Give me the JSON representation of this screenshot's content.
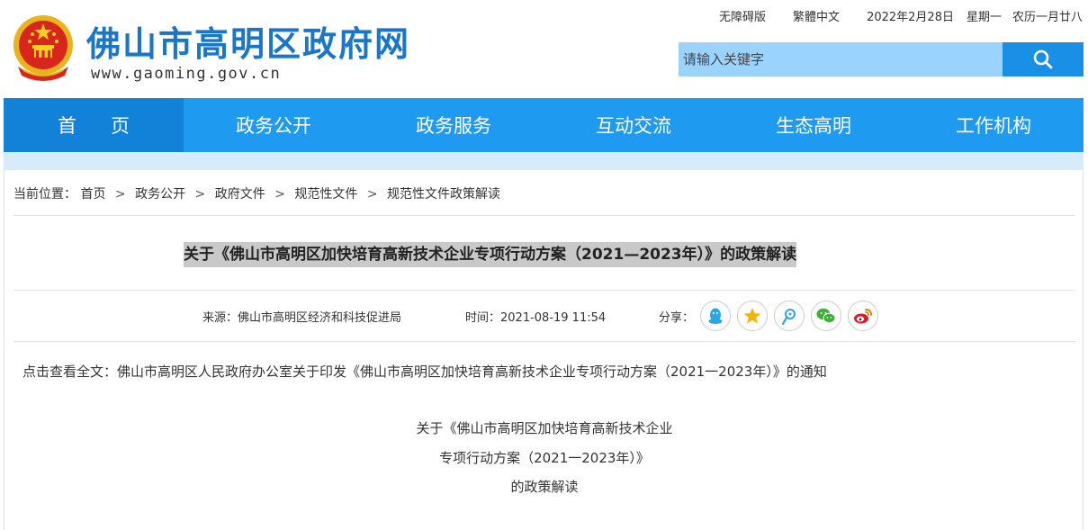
{
  "header": {
    "site_title": "佛山市高明区政府网",
    "site_url": "www.gaoming.gov.cn",
    "accessibility": "无障碍版",
    "traditional": "繁體中文",
    "date": "2022年2月28日",
    "weekday": "星期一",
    "lunar": "农历一月廿八"
  },
  "search": {
    "placeholder": "请输入关键字",
    "icon": "search-icon"
  },
  "nav": {
    "items": [
      "首页",
      "政务公开",
      "政务服务",
      "互动交流",
      "生态高明",
      "工作机构"
    ]
  },
  "breadcrumb": {
    "prefix": "当前位置：",
    "items": [
      "首页",
      "政务公开",
      "政府文件",
      "规范性文件",
      "规范性文件政策解读"
    ],
    "separator": ">"
  },
  "article": {
    "title": "关于《佛山市高明区加快培育高新技术企业专项行动方案（2021—2023年）》的政策解读",
    "source": "来源：佛山市高明区经济和科技促进局",
    "time": "时间：2021-08-19 11:54",
    "share_label": "分享：",
    "fulltext_link": "点击查看全文：佛山市高明区人民政府办公室关于印发《佛山市高明区加快培育高新技术企业专项行动方案（2021一2023年）》的通知",
    "body_title_line1": "关于《佛山市高明区加快培育高新技术企业",
    "body_title_line2": "专项行动方案（2021一2023年）》",
    "body_title_line3": "的政策解读"
  },
  "share": {
    "icons": [
      "qq-icon",
      "qzone-icon",
      "tencent-weibo-icon",
      "wechat-icon",
      "sina-weibo-icon"
    ]
  },
  "colors": {
    "brand_blue": "#1976c8",
    "nav_blue": "#1e9af0",
    "nav_active": "#1281d8",
    "search_bg": "#9bd3ff",
    "search_btn": "#1a8fe6",
    "title_highlight": "#c9c9c9"
  }
}
